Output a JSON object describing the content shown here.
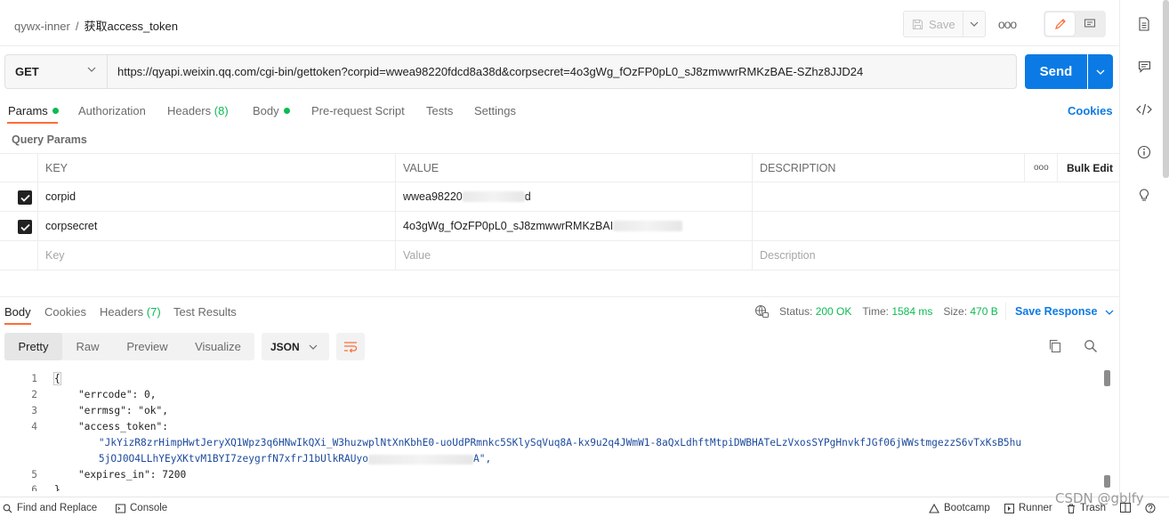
{
  "header": {
    "workspace": "qywx-inner",
    "separator": "/",
    "request_name": "获取access_token",
    "save_label": "Save",
    "more_label": "ooo"
  },
  "request": {
    "method": "GET",
    "url": "https://qyapi.weixin.qq.com/cgi-bin/gettoken?corpid=wwea98220fdcd8a38d&corpsecret=4o3gWg_fOzFP0pL0_sJ8zmwwrRMKzBAE-SZhz8JJD24",
    "send_label": "Send"
  },
  "request_tabs": [
    {
      "label": "Params",
      "dot": true
    },
    {
      "label": "Authorization"
    },
    {
      "label": "Headers",
      "count": "(8)"
    },
    {
      "label": "Body",
      "dot": true
    },
    {
      "label": "Pre-request Script"
    },
    {
      "label": "Tests"
    },
    {
      "label": "Settings"
    }
  ],
  "cookies_label": "Cookies",
  "query_params": {
    "title": "Query Params",
    "columns": {
      "key": "KEY",
      "value": "VALUE",
      "description": "DESCRIPTION",
      "more": "ooo",
      "bulk_edit": "Bulk Edit"
    },
    "rows": [
      {
        "key": "corpid",
        "value": "wwea98220",
        "value_tail": "d"
      },
      {
        "key": "corpsecret",
        "value": "4o3gWg_fOzFP0pL0_sJ8zmwwrRMKzBAI",
        "value_tail": ""
      }
    ],
    "placeholders": {
      "key": "Key",
      "value": "Value",
      "description": "Description"
    }
  },
  "response": {
    "tabs": [
      {
        "label": "Body"
      },
      {
        "label": "Cookies"
      },
      {
        "label": "Headers",
        "count": "(7)"
      },
      {
        "label": "Test Results"
      }
    ],
    "status_label": "Status:",
    "status_value": "200 OK",
    "time_label": "Time:",
    "time_value": "1584 ms",
    "size_label": "Size:",
    "size_value": "470 B",
    "save_response_label": "Save Response",
    "views": [
      "Pretty",
      "Raw",
      "Preview",
      "Visualize"
    ],
    "format": "JSON",
    "code_lines": [
      {
        "num": "1",
        "text": "{"
      },
      {
        "num": "2",
        "text": "    \"errcode\": 0,"
      },
      {
        "num": "3",
        "text": "    \"errmsg\": \"ok\","
      },
      {
        "num": "4",
        "text": "    \"access_token\":"
      },
      {
        "num": "",
        "text": "        \"JkYizR8zrHimpHwtJeryXQ1Wpz3q6HNwIkQXi_W3huzwplNtXnKbhE0-uoUdPRmnkc5SKlySqVuq8A-kx9u2q4JWmW1-8aQxLdhftMtpiDWBHATeLzVxosSYPgHnvkfJGf06jWWstmgezzS6vTxKsB5hu"
      },
      {
        "num": "",
        "text": "        5jOJ0O4LLhYEyXKtvM1BYI7zeygrfN7xfrJ1bUlkRAUyo"
      },
      {
        "num": "5",
        "text": "    \"expires_in\": 7200"
      },
      {
        "num": "6",
        "text": "}"
      }
    ],
    "line6_tail": "A\","
  },
  "bottombar": {
    "find_replace": "Find and Replace",
    "console": "Console",
    "bootcamp": "Bootcamp",
    "runner": "Runner",
    "trash": "Trash"
  },
  "watermark": "CSDN @gblfy",
  "colors": {
    "accent": "#ff6c37",
    "send": "#0c7ae4",
    "ok": "#0cbb52"
  }
}
